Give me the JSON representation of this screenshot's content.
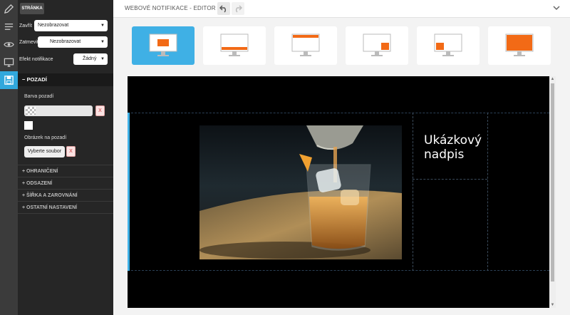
{
  "topbar": {
    "title": "WEBOVÉ NOTIFIKACE - EDITOR"
  },
  "sidebar": {
    "tab_label": "STRÁNKA",
    "close_label": "Zavřít",
    "close_value": "Nezobrazovat",
    "dim_label": "Zatmevit",
    "dim_value": "Nezobrazovat",
    "effect_label": "Efekt notifikace",
    "effect_value": "Žádný",
    "background_section": "− POZADÍ",
    "bg_color_label": "Barva pozadí",
    "clear_label": "X",
    "bg_image_label": "Obrázek na pozadí",
    "choose_file_label": "Vyberte soubor",
    "sections": [
      "+ OHRANIČENÍ",
      "+ ODSAZENÍ",
      "+ ŠÍŘKA A ZAROVNÁNÍ",
      "+ OSTATNÍ NASTAVENÍ"
    ]
  },
  "canvas": {
    "heading_line1": "Ukázkový",
    "heading_line2": "nadpis"
  },
  "colors": {
    "accent": "#3fb0e5",
    "panel": "#262626",
    "orange": "#f26a16"
  },
  "icons": [
    "pencil-icon",
    "text-lines-icon",
    "eye-icon",
    "monitor-icon",
    "save-icon",
    "undo-icon",
    "redo-icon",
    "chevron-down-icon"
  ]
}
